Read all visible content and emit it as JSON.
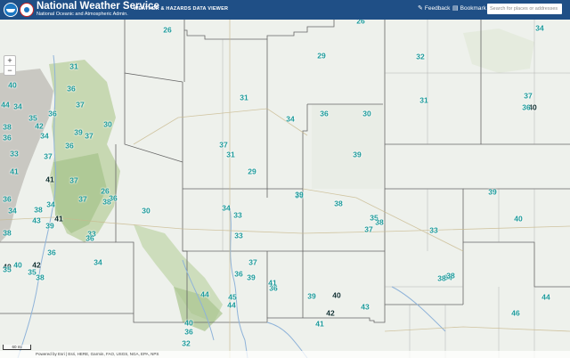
{
  "header": {
    "title": "National Weather Service",
    "subtitle_1": "National Oceanic and Atmospheric Admin.",
    "viewer_title": "WEATHER & HAZARDS DATA VIEWER",
    "feedback_label": "Feedback",
    "bookmark_label": "Bookmark",
    "search_placeholder": "Search for places or addresses"
  },
  "controls": {
    "zoom_in": "+",
    "zoom_out": "−"
  },
  "scale_label": "60 mi",
  "attribution": "Powered by Esri | Esri, HERE, Garmin, FAO, USGS, NGA, EPA, NPS",
  "station_values": [
    "26",
    "26",
    "34",
    "32",
    "29",
    "31",
    "31",
    "30",
    "40",
    "36",
    "44",
    "34",
    "35",
    "36",
    "37",
    "37",
    "40",
    "36",
    "31",
    "34",
    "36",
    "38",
    "36",
    "42",
    "30",
    "39",
    "37",
    "34",
    "36",
    "37",
    "31",
    "29",
    "39",
    "33",
    "37",
    "41",
    "41",
    "37",
    "36",
    "34",
    "38",
    "26",
    "38",
    "37",
    "36",
    "30",
    "38",
    "36",
    "34",
    "35",
    "39",
    "38",
    "41",
    "33",
    "33",
    "34",
    "38",
    "39",
    "43",
    "33",
    "36",
    "34",
    "36",
    "37",
    "40",
    "39",
    "33",
    "37",
    "34",
    "44",
    "46",
    "38",
    "38",
    "36",
    "45",
    "36",
    "39",
    "41",
    "44",
    "44",
    "40",
    "39",
    "43",
    "42",
    "35",
    "40",
    "35",
    "40",
    "38",
    "42",
    "41",
    "40",
    "36",
    "32"
  ]
}
